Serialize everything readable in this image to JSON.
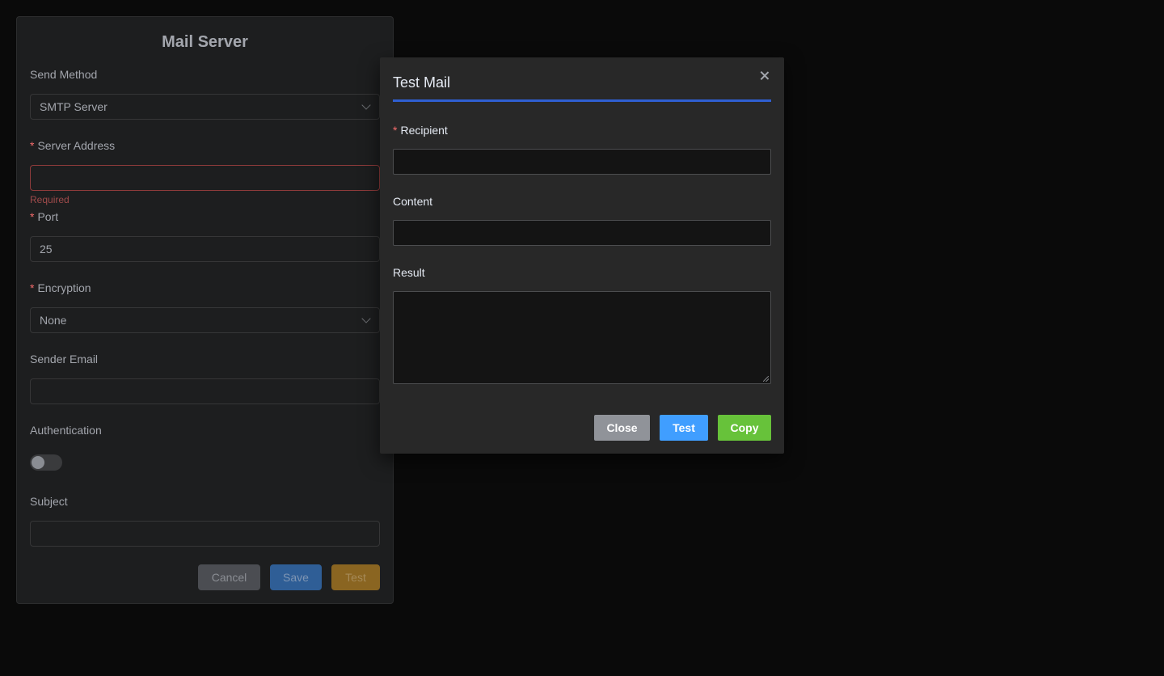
{
  "panel": {
    "title": "Mail Server",
    "send_method": {
      "label": "Send Method",
      "value": "SMTP Server"
    },
    "server_address": {
      "label": "Server Address",
      "value": "",
      "error": "Required"
    },
    "port": {
      "label": "Port",
      "value": "25"
    },
    "encryption": {
      "label": "Encryption",
      "value": "None"
    },
    "sender_email": {
      "label": "Sender Email",
      "value": ""
    },
    "authentication": {
      "label": "Authentication",
      "enabled": false
    },
    "subject": {
      "label": "Subject",
      "value": ""
    },
    "buttons": {
      "cancel": "Cancel",
      "save": "Save",
      "test": "Test"
    },
    "required_mark": "*"
  },
  "modal": {
    "title": "Test Mail",
    "required_mark": "*",
    "recipient_label": "Recipient",
    "recipient_value": "",
    "content_label": "Content",
    "content_value": "",
    "result_label": "Result",
    "result_value": "",
    "buttons": {
      "close": "Close",
      "test": "Test",
      "copy": "Copy"
    }
  },
  "colors": {
    "accent_rule": "#2f5fd1",
    "close_button": "#909399",
    "test_button": "#409eff",
    "copy_button": "#67c23a",
    "required": "#f56c6c"
  }
}
